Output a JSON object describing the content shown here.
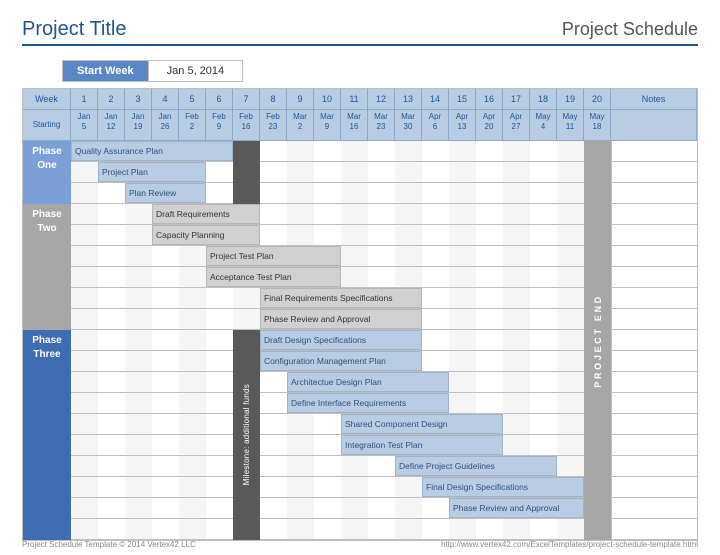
{
  "header": {
    "project_title": "Project Title",
    "schedule_title": "Project Schedule"
  },
  "startweek": {
    "label": "Start Week",
    "value": "Jan 5, 2014"
  },
  "columns": {
    "week_label": "Week",
    "starting_label": "Starting",
    "notes_label": "Notes",
    "weeks": [
      {
        "n": "1",
        "date": "Jan 5"
      },
      {
        "n": "2",
        "date": "Jan 12"
      },
      {
        "n": "3",
        "date": "Jan 19"
      },
      {
        "n": "4",
        "date": "Jan 26"
      },
      {
        "n": "5",
        "date": "Feb 2"
      },
      {
        "n": "6",
        "date": "Feb 9"
      },
      {
        "n": "7",
        "date": "Feb 16"
      },
      {
        "n": "8",
        "date": "Feb 23"
      },
      {
        "n": "9",
        "date": "Mar 2"
      },
      {
        "n": "10",
        "date": "Mar 9"
      },
      {
        "n": "11",
        "date": "Mar 16"
      },
      {
        "n": "12",
        "date": "Mar 23"
      },
      {
        "n": "13",
        "date": "Mar 30"
      },
      {
        "n": "14",
        "date": "Apr 6"
      },
      {
        "n": "15",
        "date": "Apr 13"
      },
      {
        "n": "16",
        "date": "Apr 20"
      },
      {
        "n": "17",
        "date": "Apr 27"
      },
      {
        "n": "18",
        "date": "May 4"
      },
      {
        "n": "19",
        "date": "May 11"
      },
      {
        "n": "20",
        "date": "May 18"
      }
    ]
  },
  "phases": [
    {
      "id": "one",
      "name": "Phase",
      "sub": "One"
    },
    {
      "id": "two",
      "name": "Phase",
      "sub": "Two"
    },
    {
      "id": "three",
      "name": "Phase",
      "sub": "Three"
    }
  ],
  "milestone_label": "Milestone: additional funds",
  "project_end_label": "PROJECT END",
  "chart_data": {
    "type": "gantt",
    "x_unit": "week",
    "x_range": [
      1,
      20
    ],
    "series": [
      {
        "row": 0,
        "start": 1,
        "span": 6,
        "label": "Quality Assurance Plan",
        "phase": "one",
        "color": "blue"
      },
      {
        "row": 1,
        "start": 2,
        "span": 4,
        "label": "Project Plan",
        "phase": "one",
        "color": "blue"
      },
      {
        "row": 2,
        "start": 3,
        "span": 3,
        "label": "Plan Review",
        "phase": "one",
        "color": "blue"
      },
      {
        "row": 3,
        "start": 4,
        "span": 4,
        "label": "Draft Requirements",
        "phase": "two",
        "color": "grey"
      },
      {
        "row": 4,
        "start": 4,
        "span": 4,
        "label": "Capacity Planning",
        "phase": "two",
        "color": "grey"
      },
      {
        "row": 5,
        "start": 6,
        "span": 5,
        "label": "Project Test Plan",
        "phase": "two",
        "color": "grey"
      },
      {
        "row": 6,
        "start": 6,
        "span": 5,
        "label": "Acceptance Test Plan",
        "phase": "two",
        "color": "grey"
      },
      {
        "row": 7,
        "start": 8,
        "span": 6,
        "label": "Final Requirements Specifications",
        "phase": "two",
        "color": "grey"
      },
      {
        "row": 8,
        "start": 8,
        "span": 6,
        "label": "Phase Review and Approval",
        "phase": "two",
        "color": "grey"
      },
      {
        "row": 9,
        "start": 8,
        "span": 6,
        "label": "Draft Design Specifications",
        "phase": "three",
        "color": "blue"
      },
      {
        "row": 10,
        "start": 8,
        "span": 6,
        "label": "Configuration Management Plan",
        "phase": "three",
        "color": "blue"
      },
      {
        "row": 11,
        "start": 9,
        "span": 6,
        "label": "Architectue Design Plan",
        "phase": "three",
        "color": "blue"
      },
      {
        "row": 12,
        "start": 9,
        "span": 6,
        "label": "Define Interface Requirements",
        "phase": "three",
        "color": "blue"
      },
      {
        "row": 13,
        "start": 11,
        "span": 6,
        "label": "Shared Component Design",
        "phase": "three",
        "color": "blue"
      },
      {
        "row": 14,
        "start": 11,
        "span": 6,
        "label": "Integration Test Plan",
        "phase": "three",
        "color": "blue"
      },
      {
        "row": 15,
        "start": 13,
        "span": 6,
        "label": "Define Project Guidelines",
        "phase": "three",
        "color": "blue"
      },
      {
        "row": 16,
        "start": 14,
        "span": 6,
        "label": "Final Design Specifications",
        "phase": "three",
        "color": "blue"
      },
      {
        "row": 17,
        "start": 15,
        "span": 5,
        "label": "Phase Review and Approval",
        "phase": "three",
        "color": "blue"
      }
    ],
    "markers": [
      {
        "week": 7,
        "label": "Milestone: additional funds"
      },
      {
        "week": 20,
        "label": "PROJECT END"
      }
    ]
  },
  "footer": {
    "left": "Project Schedule Template © 2014 Vertex42 LLC",
    "right": "http://www.vertex42.com/ExcelTemplates/project-schedule-template.html"
  }
}
